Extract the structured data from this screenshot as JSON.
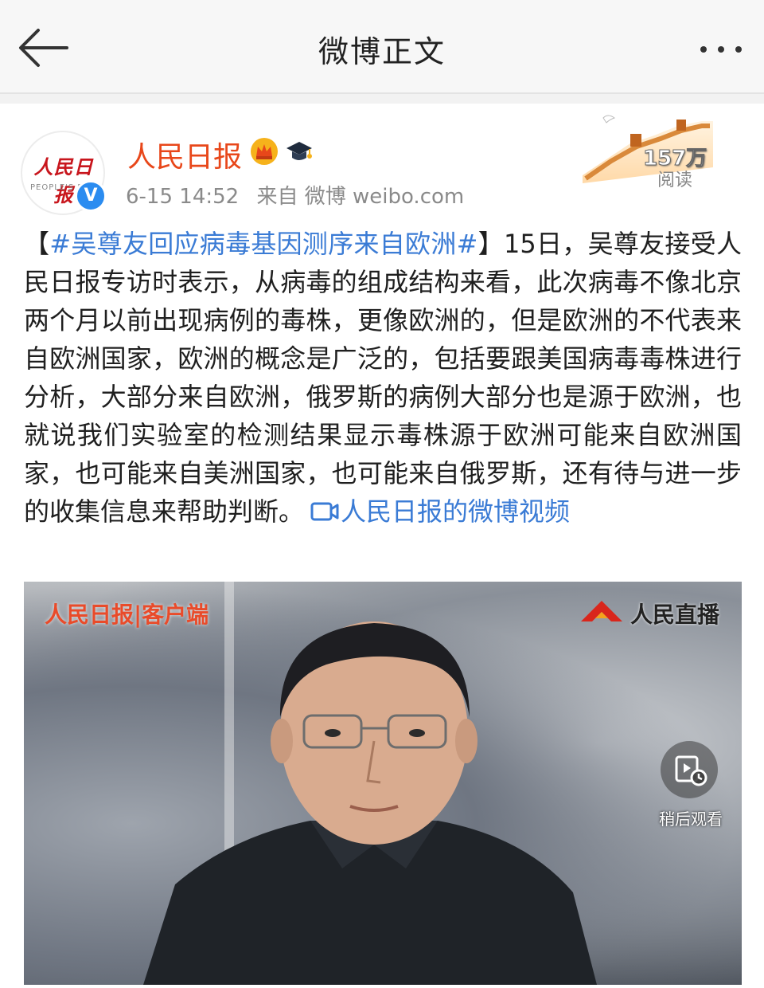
{
  "nav": {
    "title": "微博正文"
  },
  "post": {
    "author": "人民日报",
    "avatar_logo_text": "人民日报",
    "avatar_sub_text": "PEOPLE'S D",
    "verified_mark": "V",
    "time": "6-15 14:52",
    "source": "来自 微博 weibo.com",
    "reads_count": "157万",
    "reads_label": "阅读",
    "bracket_open": "【",
    "hashtag": "#吴尊友回应病毒基因测序来自欧洲#",
    "bracket_close": "】",
    "text": "15日，吴尊友接受人民日报专访时表示，从病毒的组成结构来看，此次病毒不像北京两个月以前出现病例的毒株，更像欧洲的，但是欧洲的不代表来自欧洲国家，欧洲的概念是广泛的，包括要跟美国病毒毒株进行分析，大部分来自欧洲，俄罗斯的病例大部分也是源于欧洲，也就说我们实验室的检测结果显示毒株源于欧洲可能来自欧洲国家，也可能来自美洲国家，也可能来自俄罗斯，还有待与进一步的收集信息来帮助判断。",
    "video_link_label": "人民日报的微博视频"
  },
  "video": {
    "logo_text": "人民日报|客户端",
    "live_text": "人民直播",
    "watch_later_label": "稍后观看"
  },
  "icons": {
    "back": "back-arrow-icon",
    "more": "more-dots-icon",
    "crown": "crown-icon",
    "cap": "graduation-cap-icon",
    "video": "video-camera-icon",
    "watch_later": "watch-later-icon"
  },
  "colors": {
    "author": "#e8471a",
    "link": "#3a7bd5",
    "verified": "#2b8cf0"
  }
}
